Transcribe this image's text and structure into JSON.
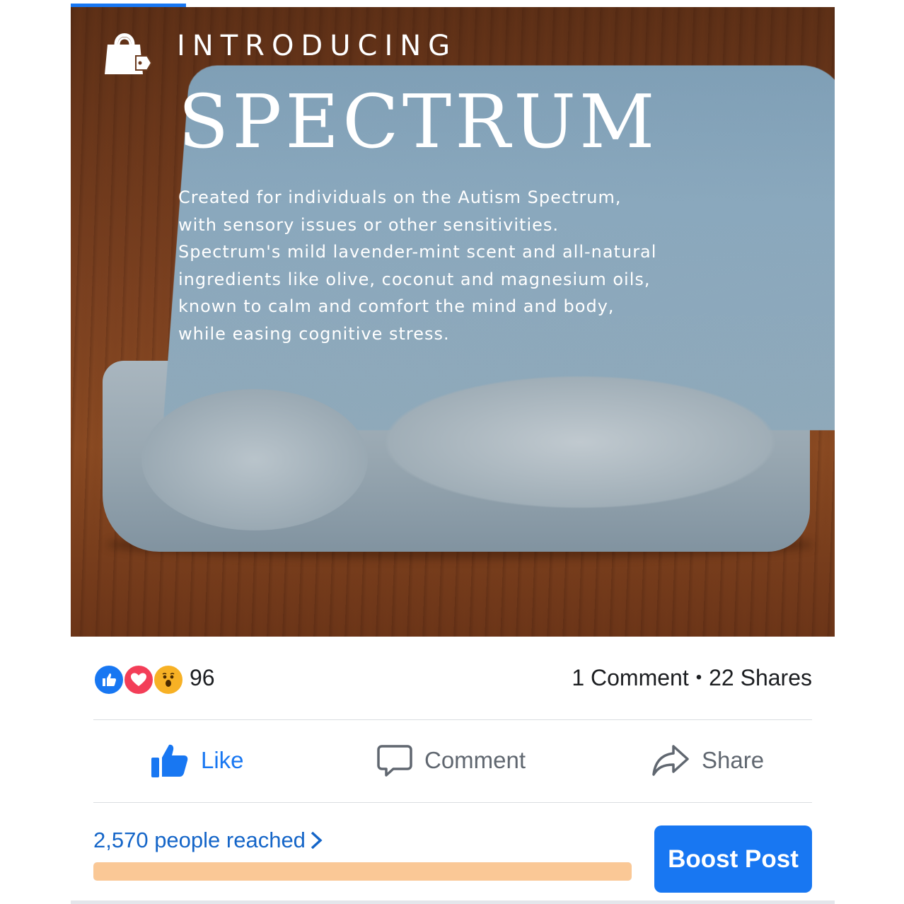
{
  "post": {
    "image": {
      "kicker": "INTRODUCING",
      "title": "SPECTRUM",
      "description": "Created for individuals on the Autism Spectrum,\nwith sensory issues or other sensitivities.\nSpectrum's mild lavender-mint scent and all-natural\ningredients like olive, coconut and magnesium oils,\nknown to calm and comfort the mind and body,\nwhile easing cognitive stress.",
      "logo_icon": "shopping-bag-tag-icon"
    },
    "reactions": {
      "types": [
        "like",
        "love",
        "wow"
      ],
      "count": "96"
    },
    "comments_label": "1 Comment",
    "separator": "•",
    "shares_label": "22 Shares"
  },
  "actions": {
    "like_label": "Like",
    "comment_label": "Comment",
    "share_label": "Share"
  },
  "insights": {
    "reach_label": "2,570 people reached",
    "reach_progress": 1.0,
    "boost_label": "Boost Post"
  },
  "colors": {
    "accent": "#1877f2",
    "reach_text": "#1465c8",
    "reach_bar": "#fac896",
    "love": "#f33e58",
    "wow": "#f7b125"
  }
}
